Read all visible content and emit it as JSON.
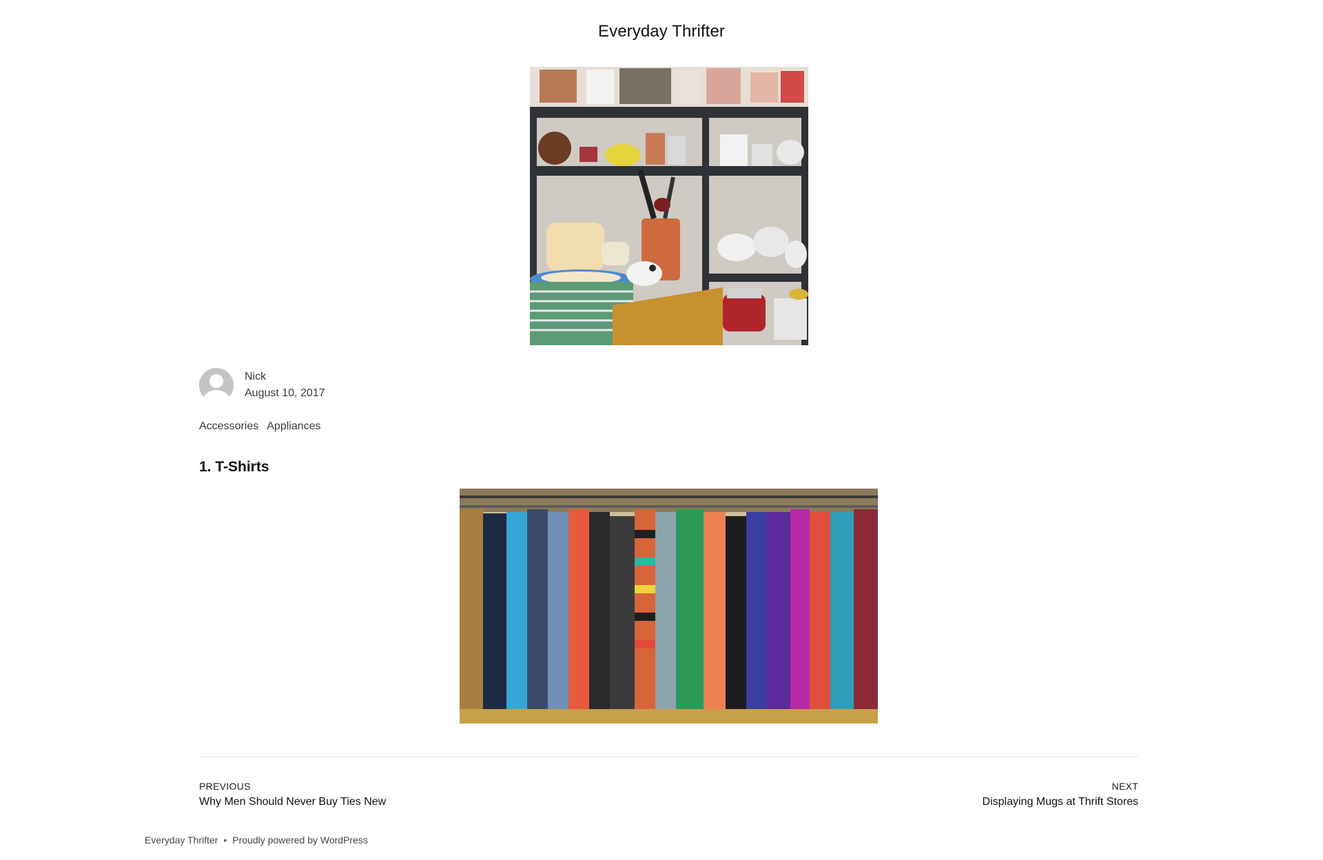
{
  "site": {
    "title": "Everyday Thrifter"
  },
  "featured_image": {
    "icon": "kitchenware-shelves-photo"
  },
  "post": {
    "author": "Nick",
    "date": "August 10, 2017",
    "categories": [
      "Accessories",
      "Appliances"
    ],
    "heading": "1. T-Shirts",
    "content_image": {
      "icon": "clothing-rack-photo"
    }
  },
  "navigation": {
    "previous": {
      "kicker": "PREVIOUS",
      "title": "Why Men Should Never Buy Ties New"
    },
    "next": {
      "kicker": "NEXT",
      "title": "Displaying Mugs at Thrift Stores"
    }
  },
  "footer": {
    "site_name": "Everyday Thrifter",
    "separator": "•",
    "powered": "Proudly powered by WordPress"
  }
}
